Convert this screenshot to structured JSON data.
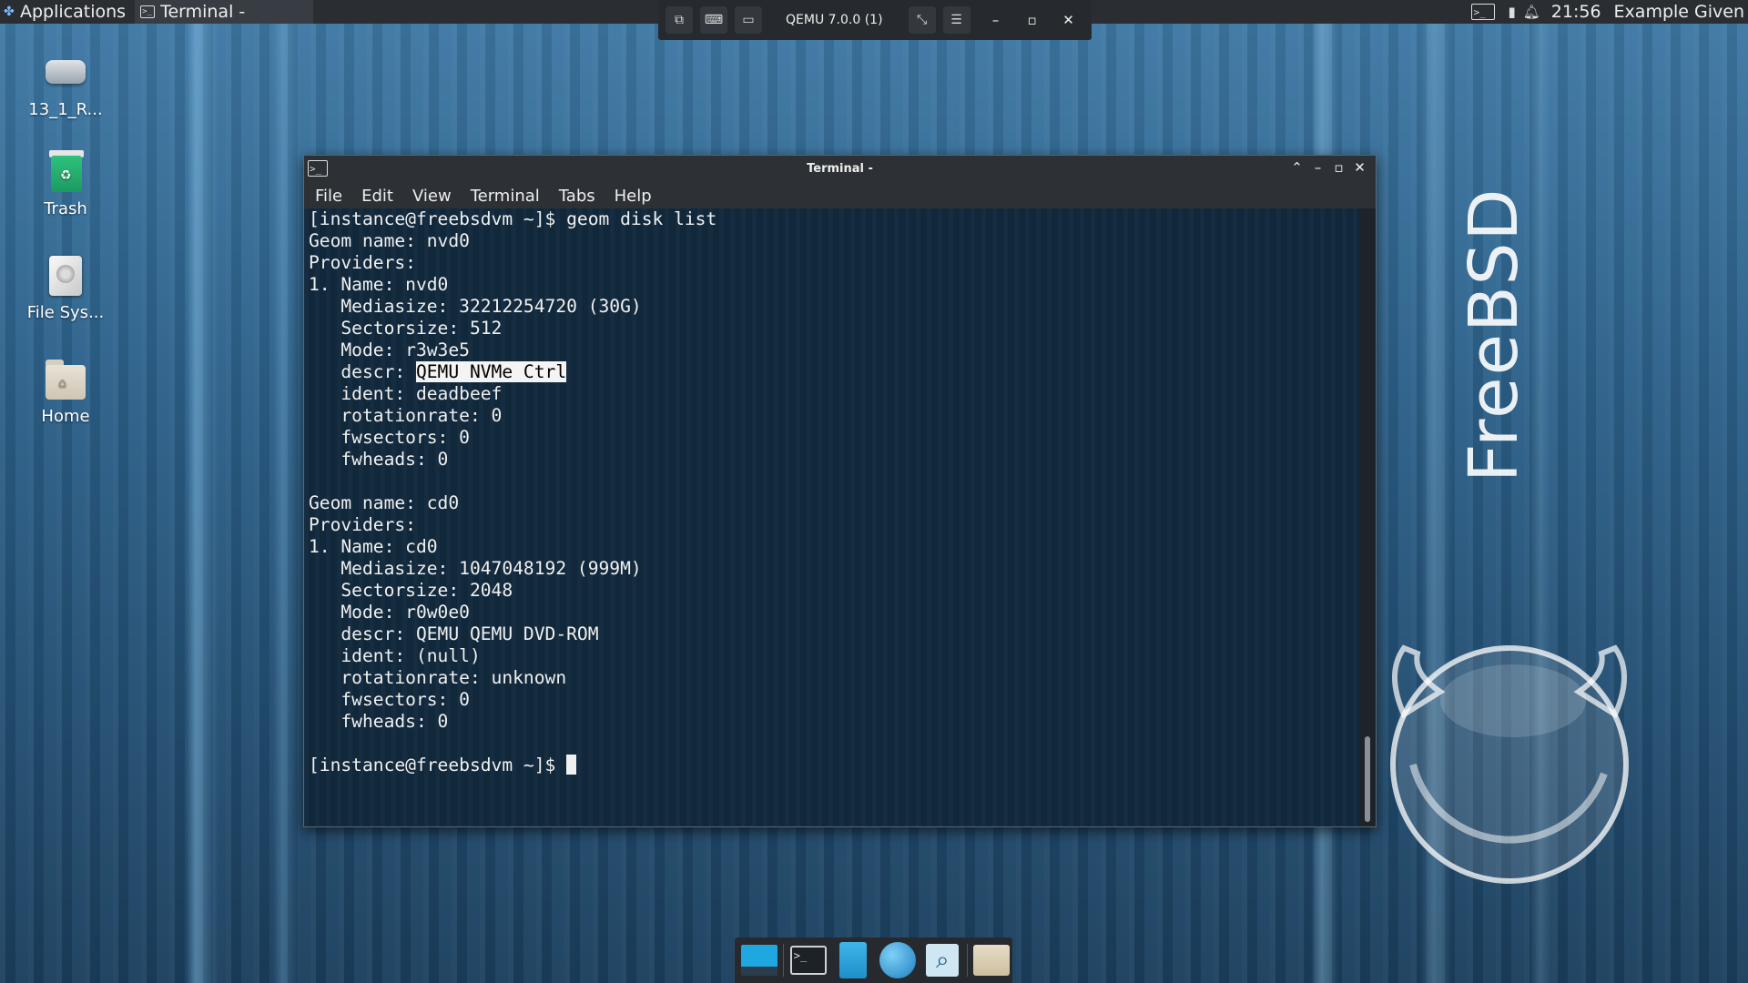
{
  "panel": {
    "applications_label": "Applications",
    "taskbar_terminal_label": "Terminal -",
    "clock": "21:56",
    "user": "Example Given"
  },
  "qemu": {
    "title": "QEMU 7.0.0 (1)"
  },
  "desktop": {
    "icons": [
      {
        "label": "13_1_R...",
        "icon": "drive-icon"
      },
      {
        "label": "Trash",
        "icon": "trash-icon"
      },
      {
        "label": "File Sys...",
        "icon": "harddisk-icon"
      },
      {
        "label": "Home",
        "icon": "home-folder-icon"
      }
    ],
    "wallpaper_text": "FreeBSD"
  },
  "terminal": {
    "title": "Terminal -",
    "menu": [
      "File",
      "Edit",
      "View",
      "Terminal",
      "Tabs",
      "Help"
    ],
    "lines_before": "[instance@freebsdvm ~]$ geom disk list\nGeom name: nvd0\nProviders:\n1. Name: nvd0\n   Mediasize: 32212254720 (30G)\n   Sectorsize: 512\n   Mode: r3w3e5\n   descr: ",
    "selected_text": "QEMU NVMe Ctrl",
    "lines_after": "\n   ident: deadbeef\n   rotationrate: 0\n   fwsectors: 0\n   fwheads: 0\n\nGeom name: cd0\nProviders:\n1. Name: cd0\n   Mediasize: 1047048192 (999M)\n   Sectorsize: 2048\n   Mode: r0w0e0\n   descr: QEMU QEMU DVD-ROM\n   ident: (null)\n   rotationrate: unknown\n   fwsectors: 0\n   fwheads: 0\n\n[instance@freebsdvm ~]$ "
  },
  "dock": {
    "items": [
      "show-desktop-icon",
      "terminal-icon",
      "file-manager-icon",
      "web-browser-icon",
      "search-icon",
      "folder-icon"
    ]
  },
  "colors": {
    "panel_bg": "#2a2e33",
    "terminal_bg": "#122a3e",
    "selection_bg": "#f4f4f4"
  }
}
